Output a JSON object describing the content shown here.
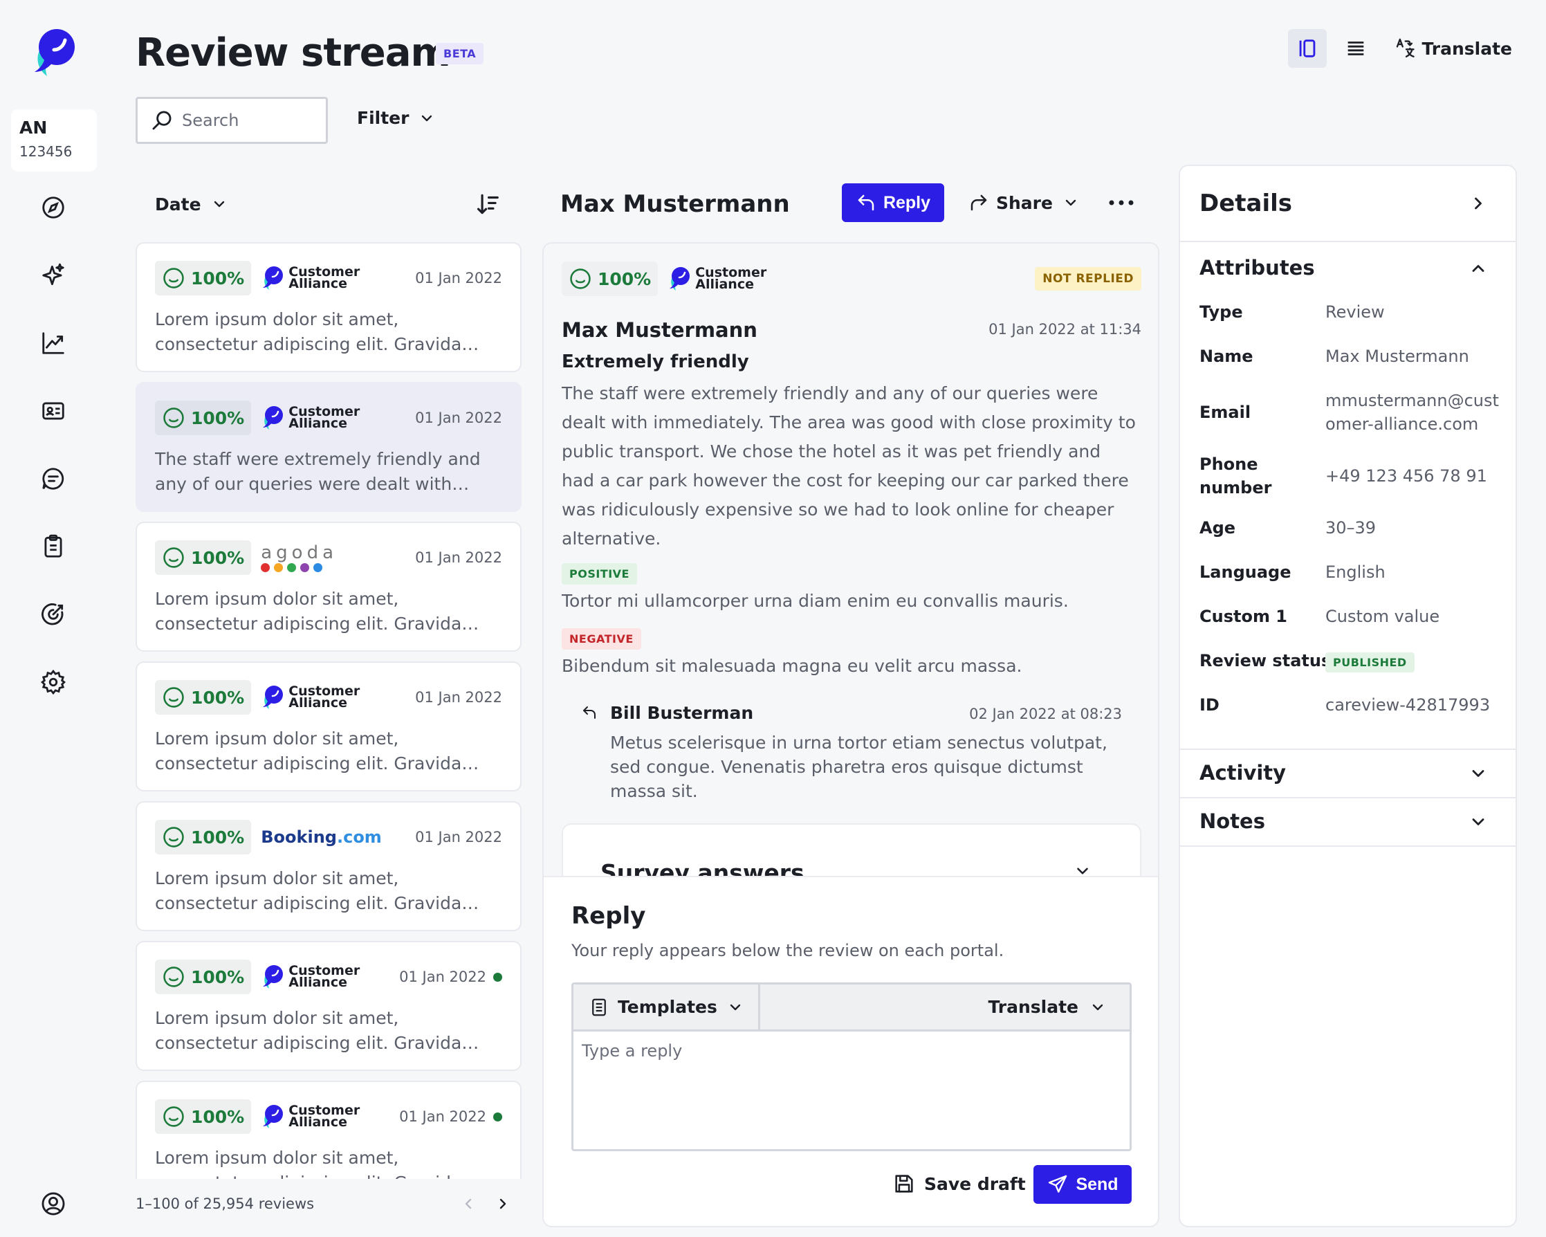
{
  "app": {
    "title": "Review stream",
    "badge": "BETA",
    "account": {
      "initials": "AN",
      "number": "123456"
    }
  },
  "nav_icons": [
    "compass-icon",
    "sparkle-icon",
    "chart-icon",
    "contact-card-icon",
    "chat-icon",
    "clipboard-icon",
    "target-icon",
    "gear-icon",
    "user-circle-icon"
  ],
  "toolbar": {
    "search_placeholder": "Search",
    "filter_label": "Filter",
    "translate_label": "Translate"
  },
  "list": {
    "sort_label": "Date",
    "pagination": "1–100 of 25,954 reviews",
    "items": [
      {
        "score": "100%",
        "portal": "customer-alliance",
        "portal_name": "Customer Alliance",
        "date": "01 Jan 2022",
        "excerpt": "Lorem ipsum dolor sit amet, consectetur adipiscing elit. Gravida scelerisque ac a...",
        "selected": false,
        "unread": false
      },
      {
        "score": "100%",
        "portal": "customer-alliance",
        "portal_name": "Customer Alliance",
        "date": "01 Jan 2022",
        "excerpt": "The staff were extremely friendly and any of our queries were dealt with immedia...",
        "selected": true,
        "unread": false
      },
      {
        "score": "100%",
        "portal": "agoda",
        "portal_name": "agoda",
        "date": "01 Jan 2022",
        "excerpt": "Lorem ipsum dolor sit amet, consectetur adipiscing elit. Gravida scelerisque ac a...",
        "selected": false,
        "unread": false
      },
      {
        "score": "100%",
        "portal": "customer-alliance",
        "portal_name": "Customer Alliance",
        "date": "01 Jan 2022",
        "excerpt": "Lorem ipsum dolor sit amet, consectetur adipiscing elit. Gravida scelerisque ac a...",
        "selected": false,
        "unread": false
      },
      {
        "score": "100%",
        "portal": "booking",
        "portal_name": "Booking",
        "portal_suffix": ".com",
        "date": "01 Jan 2022",
        "excerpt": "Lorem ipsum dolor sit amet, consectetur adipiscing elit. Gravida scelerisque ac a...",
        "selected": false,
        "unread": false
      },
      {
        "score": "100%",
        "portal": "customer-alliance",
        "portal_name": "Customer Alliance",
        "date": "01 Jan 2022",
        "excerpt": "Lorem ipsum dolor sit amet, consectetur adipiscing elit. Gravida scelerisque ac a...",
        "selected": false,
        "unread": true
      },
      {
        "score": "100%",
        "portal": "customer-alliance",
        "portal_name": "Customer Alliance",
        "date": "01 Jan 2022",
        "excerpt": "Lorem ipsum dolor sit amet, consectetur adipiscing elit. Gravida scelerisque ac a...",
        "selected": false,
        "unread": true
      }
    ]
  },
  "review": {
    "header_name": "Max Mustermann",
    "reply_label": "Reply",
    "share_label": "Share",
    "score": "100%",
    "portal_name": "Customer Alliance",
    "status": "NOT REPLIED",
    "author": "Max Mustermann",
    "date": "01 Jan 2022 at 11:34",
    "title": "Extremely friendly",
    "body": "The staff were extremely friendly and any of our queries were dealt with immediately. The area was good with close proximity to public transport. We chose the hotel as it was pet friendly and had a car park however the cost for keeping our car parked there was ridiculously expensive so we had to look online for cheaper alternative.",
    "positive_label": "POSITIVE",
    "positive_text": "Tortor mi ullamcorper urna diam enim eu convallis mauris.",
    "negative_label": "NEGATIVE",
    "negative_text": "Bibendum sit malesuada magna eu velit arcu massa.",
    "answer": {
      "author": "Bill Busterman",
      "date": "02 Jan 2022 at 08:23",
      "text": "Metus scelerisque in urna tortor etiam senectus volutpat, sed congue. Venenatis pharetra eros quisque dictumst massa sit."
    },
    "survey_label": "Survey answers"
  },
  "reply": {
    "title": "Reply",
    "subtitle": "Your reply appears below the review on each portal.",
    "templates_label": "Templates",
    "translate_label": "Translate",
    "placeholder": "Type a reply",
    "save_draft_label": "Save draft",
    "send_label": "Send"
  },
  "details": {
    "title": "Details",
    "attributes_label": "Attributes",
    "attributes": [
      {
        "key": "Type",
        "value": "Review"
      },
      {
        "key": "Name",
        "value": "Max Mustermann"
      },
      {
        "key": "Email",
        "value": "mmustermann@customer-alliance.com"
      },
      {
        "key": "Phone number",
        "value": "+49 123 456 78 91"
      },
      {
        "key": "Age",
        "value": "30–39"
      },
      {
        "key": "Language",
        "value": "English"
      },
      {
        "key": "Custom 1",
        "value": "Custom value"
      },
      {
        "key": "Review status",
        "value": "PUBLISHED"
      },
      {
        "key": "ID",
        "value": "careview-42817993"
      }
    ],
    "activity_label": "Activity",
    "notes_label": "Notes"
  },
  "colors": {
    "accent": "#2d1ee6",
    "positive": "#1c7a3a",
    "negative": "#c3262a",
    "warning_bg": "#fcf2c6"
  }
}
